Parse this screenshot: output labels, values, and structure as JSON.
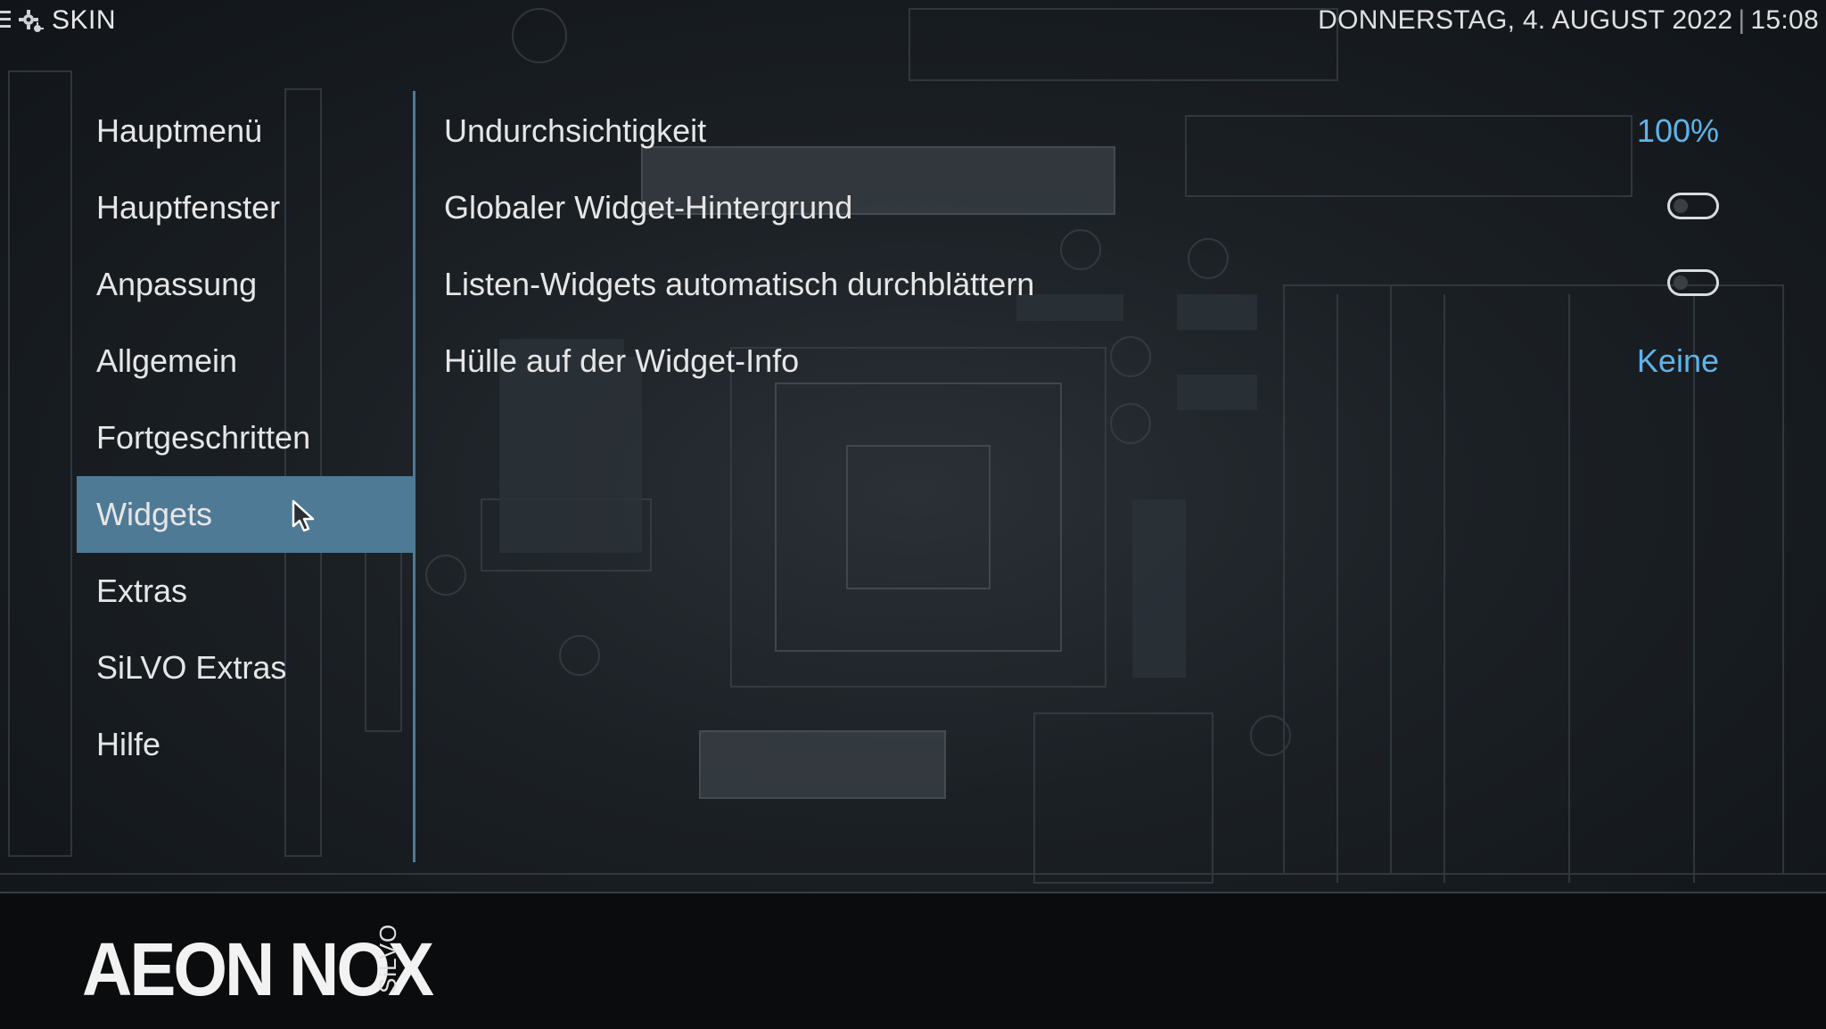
{
  "topbar": {
    "section_title": "SKIN",
    "date": "DONNERSTAG, 4. AUGUST 2022",
    "separator": "|",
    "time": "15:08"
  },
  "sidebar": {
    "items": [
      {
        "label": "Hauptmenü"
      },
      {
        "label": "Hauptfenster"
      },
      {
        "label": "Anpassung"
      },
      {
        "label": "Allgemein"
      },
      {
        "label": "Fortgeschritten"
      },
      {
        "label": "Widgets",
        "active": true
      },
      {
        "label": "Extras"
      },
      {
        "label": "SiLVO Extras"
      },
      {
        "label": "Hilfe"
      }
    ]
  },
  "settings": {
    "rows": [
      {
        "label": "Undurchsichtigkeit",
        "value": "100%"
      },
      {
        "label": "Globaler Widget-Hintergrund",
        "toggle": "off"
      },
      {
        "label": "Listen-Widgets automatisch durchblättern",
        "toggle": "off"
      },
      {
        "label": "Hülle auf der Widget-Info",
        "value": "Keine"
      }
    ]
  },
  "footer": {
    "logo": "AEON NOX",
    "logo_sub": "SiLVO"
  },
  "colors": {
    "accent": "#4f7a96",
    "value_text": "#5fb4ea",
    "background": "#101418",
    "footer": "#0b0c0d"
  },
  "icons": {
    "menu": "menu-icon",
    "settings": "gear-icon",
    "cursor": "cursor-icon"
  }
}
